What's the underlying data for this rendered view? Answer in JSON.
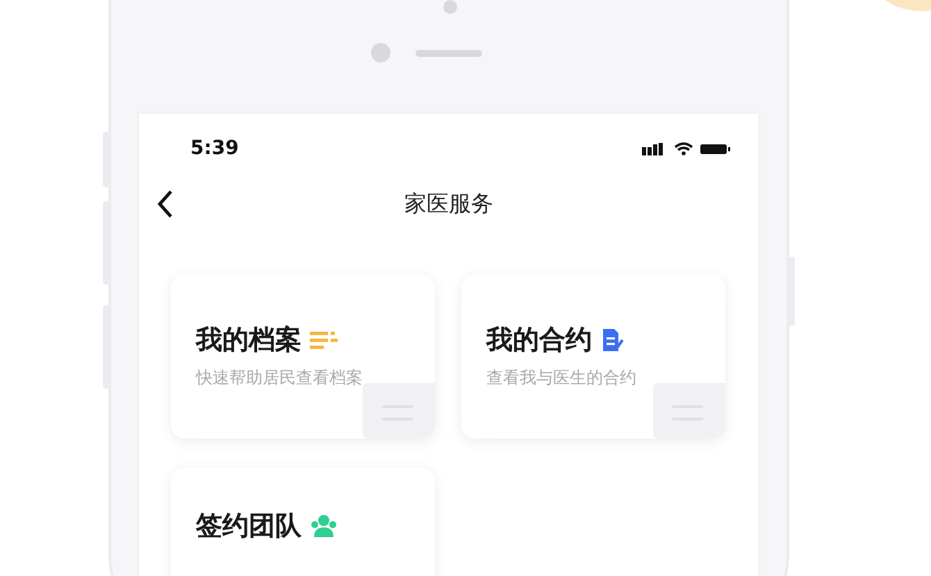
{
  "status_bar": {
    "time": "5:39"
  },
  "nav": {
    "title": "家医服务"
  },
  "cards": [
    {
      "title": "我的档案",
      "subtitle": "快速帮助居民查看档案",
      "kind": "list"
    },
    {
      "title": "我的合约",
      "subtitle": "查看我与医生的合约",
      "kind": "document"
    },
    {
      "title": "签约团队",
      "kind": "team"
    }
  ]
}
